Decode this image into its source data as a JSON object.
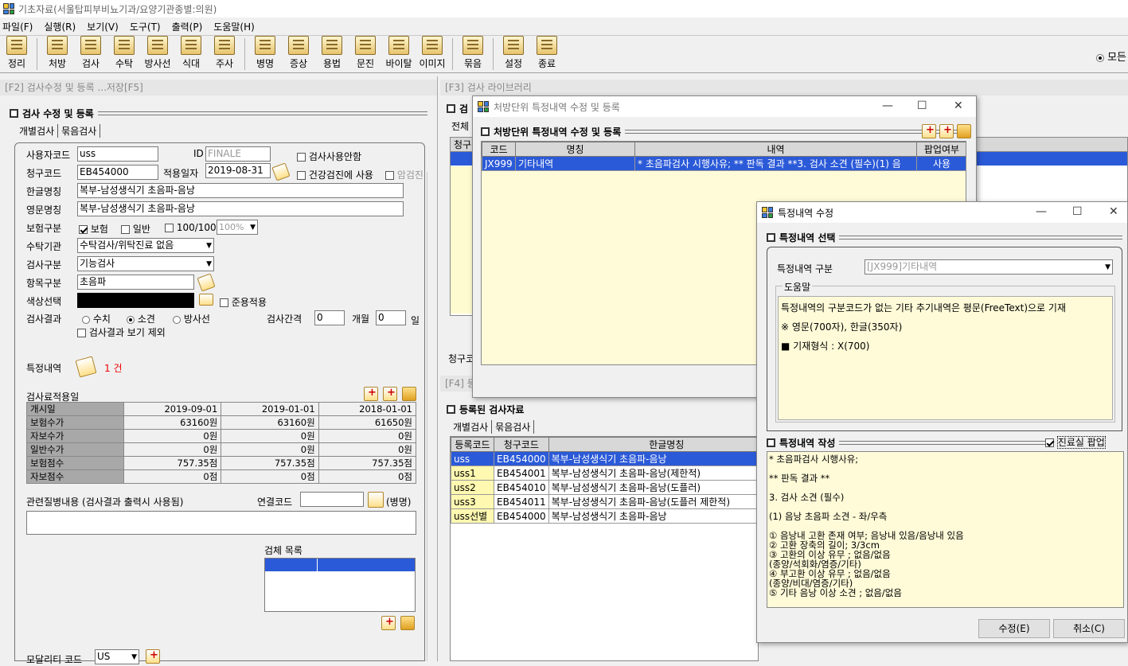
{
  "app": {
    "title": "기초자료(서울탑피부비뇨기과/요양기관종별:의원)"
  },
  "menu": [
    "파일(F)",
    "실행(R)",
    "보기(V)",
    "도구(T)",
    "출력(P)",
    "도움말(H)"
  ],
  "toolbar": {
    "groups": [
      [
        "정리"
      ],
      [
        "처방",
        "검사",
        "수탁",
        "방사선",
        "식대",
        "주사"
      ],
      [
        "병명",
        "증상",
        "용법",
        "문진",
        "바이탈",
        "이미지"
      ],
      [
        "묶음"
      ],
      [
        "설정",
        "종료"
      ]
    ],
    "right_label": "모든"
  },
  "left": {
    "panel_title": "[F2] 검사수정 및 등록 ...저장[F5]",
    "section": "검사 수정 및 등록",
    "tabs": [
      "개별검사",
      "묶음검사"
    ],
    "user_code_label": "사용자코드",
    "user_code": "uss",
    "id_label": "ID",
    "id_value": "FINALE",
    "chk_unused": "검사사용안함",
    "claim_code_label": "청구코드",
    "claim_code": "EB454000",
    "apply_date_label": "적용일자",
    "apply_date": "2019-08-31",
    "chk_health": "건강검진에 사용",
    "chk_cancer": "암검진",
    "kor_name_label": "한글명칭",
    "kor_name": "복부-남성생식기 초음파-음낭",
    "eng_name_label": "영문명칭",
    "eng_name": "복부-남성생식기 초음파-음낭",
    "ins_label": "보험구분",
    "ins_opts": [
      "보험",
      "일반",
      "100/100"
    ],
    "pct": "100%",
    "consign_label": "수탁기관",
    "consign": "수탁검사/위탁진료 없음",
    "test_type_label": "검사구분",
    "test_type": "기능검사",
    "item_type_label": "항목구분",
    "item_type": "초음파",
    "color_label": "색상선택",
    "chk_follow": "준용적용",
    "result_label": "검사결과",
    "result_opts": [
      "수치",
      "소견",
      "방사선"
    ],
    "interval_label": "검사간격",
    "interval_val": "0",
    "month_label": "개월",
    "day_val": "0",
    "day_label": "일",
    "chk_exclude": "검사결과 보기 제외",
    "special_label": "특정내역",
    "special_count": "1 건",
    "fee_label": "검사료적용일",
    "fee_rows": [
      [
        "개시일",
        "2019-09-01",
        "2019-01-01",
        "2018-01-01"
      ],
      [
        "보험수가",
        "63160원",
        "63160원",
        "61650원"
      ],
      [
        "자보수가",
        "0원",
        "0원",
        "0원"
      ],
      [
        "일반수가",
        "0원",
        "0원",
        "0원"
      ],
      [
        "보험점수",
        "757.35점",
        "757.35점",
        "757.35점"
      ],
      [
        "자보점수",
        "0점",
        "0점",
        "0점"
      ]
    ],
    "related_label": "관련질병내용 (검사결과 출력시 사용됨)",
    "link_code_label": "연결코드",
    "disease_label": "(병명)",
    "specimen_label": "검체 목록",
    "modality_label": "모달리티 코드",
    "modality": "US"
  },
  "right": {
    "panel_f3": "[F3] 검사 라이브러리",
    "sec_f3": "검",
    "whole": "전체",
    "claim": "청구",
    "panel_f4": "[F4] 등",
    "sec_reg": "등록된 검사자료",
    "tabs": [
      "개별검사",
      "묶음검사"
    ],
    "grid_headers": [
      "등록코드",
      "청구코드",
      "한글명칭"
    ],
    "grid_rows": [
      [
        "uss",
        "EB454000",
        "복부-남성생식기 초음파-음낭"
      ],
      [
        "uss1",
        "EB454001",
        "복부-남성생식기 초음파-음낭(제한적)"
      ],
      [
        "uss2",
        "EB454010",
        "복부-남성생식기 초음파-음낭(도플러)"
      ],
      [
        "uss3",
        "EB454011",
        "복부-남성생식기 초음파-음낭(도플러 제한적)"
      ],
      [
        "uss선별",
        "EB454000",
        "복부-남성생식기 초음파-음낭"
      ]
    ],
    "claim_bottom": "청구코"
  },
  "dlg1": {
    "title": "처방단위 특정내역 수정 및 등록",
    "section": "처방단위 특정내역 수정 및 등록",
    "headers": [
      "코드",
      "명칭",
      "내역",
      "팝업여부"
    ],
    "row": [
      "JX999",
      "기타내역",
      "* 초음파검사 시행사유; **  판독 결과 **3. 검사 소견 (필수)(1) 음",
      "사용"
    ]
  },
  "dlg2": {
    "title": "특정내역 수정",
    "sec_select": "특정내역 선택",
    "type_label": "특정내역 구분",
    "type_value": "[JX999]기타내역",
    "help_label": "도움말",
    "help_lines": [
      "특정내역의 구분코드가 없는 기타 추기내역은 평문(FreeText)으로 기재",
      "※ 영문(700자), 한글(350자)",
      "■ 기재형식 : X(700)"
    ],
    "sec_write": "특정내역 작성",
    "chk_popup": "진료실 팝업",
    "text_lines": [
      "* 초음파검사 시행사유;",
      "",
      "** 판독 결과 **",
      "",
      "3. 검사 소견 (필수)",
      "",
      "(1) 음낭 초음파 소견 - 좌/우측",
      "",
      "① 음낭내 고환 존재 여부; 음낭내 있음/음낭내 있음",
      "② 고환 장축의 길이;  3/3cm",
      "③ 고환의 이상 유무 ; 없음/없음",
      "(종양/석회화/염증/기타)",
      "④ 부고환 이상 유무 ; 없음/없음",
      "(종양/비대/염증/기타)",
      "⑤ 기타 음낭 이상 소견 ; 없음/없음"
    ],
    "btn_edit": "수정(E)",
    "btn_cancel": "취소(C)"
  }
}
